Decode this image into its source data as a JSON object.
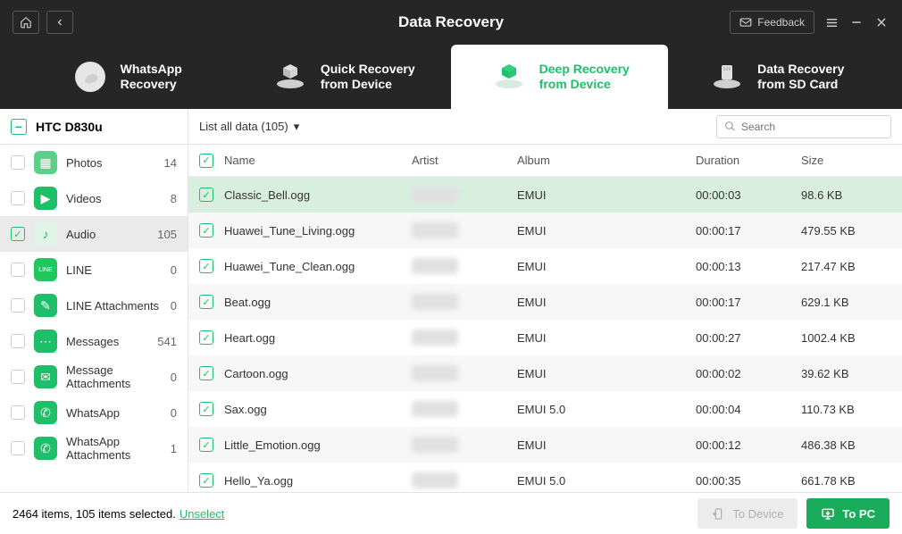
{
  "titlebar": {
    "title": "Data Recovery",
    "feedback": "Feedback"
  },
  "tabs": [
    {
      "l1": "WhatsApp",
      "l2": "Recovery"
    },
    {
      "l1": "Quick Recovery",
      "l2": "from Device"
    },
    {
      "l1": "Deep Recovery",
      "l2": "from Device"
    },
    {
      "l1": "Data Recovery",
      "l2": "from SD Card"
    }
  ],
  "device": "HTC D830u",
  "sidebar": [
    {
      "label": "Photos",
      "count": "14",
      "checked": false,
      "bg": "#5cd08a",
      "glyph": "▦"
    },
    {
      "label": "Videos",
      "count": "8",
      "checked": false,
      "bg": "#1fbf6a",
      "glyph": "▶"
    },
    {
      "label": "Audio",
      "count": "105",
      "checked": true,
      "bg": "#dff3e7",
      "glyph": "♪",
      "fg": "#1fbf6a"
    },
    {
      "label": "LINE",
      "count": "0",
      "checked": false,
      "bg": "#22c55e",
      "glyph": "LINE",
      "fs": "7"
    },
    {
      "label": "LINE Attachments",
      "count": "0",
      "checked": false,
      "bg": "#1fbf6a",
      "glyph": "✎"
    },
    {
      "label": "Messages",
      "count": "541",
      "checked": false,
      "bg": "#1fbf6a",
      "glyph": "⋯"
    },
    {
      "label": "Message Attachments",
      "count": "0",
      "checked": false,
      "bg": "#1fbf6a",
      "glyph": "✉"
    },
    {
      "label": "WhatsApp",
      "count": "0",
      "checked": false,
      "bg": "#1fbf6a",
      "glyph": "✆"
    },
    {
      "label": "WhatsApp Attachments",
      "count": "1",
      "checked": false,
      "bg": "#1fbf6a",
      "glyph": "✆"
    }
  ],
  "listLabel": "List all data (105)",
  "searchPlaceholder": "Search",
  "columns": {
    "name": "Name",
    "artist": "Artist",
    "album": "Album",
    "duration": "Duration",
    "size": "Size"
  },
  "rows": [
    {
      "name": "Classic_Bell.ogg",
      "album": "EMUI",
      "duration": "00:00:03",
      "size": "98.6 KB",
      "sel": true
    },
    {
      "name": "Huawei_Tune_Living.ogg",
      "album": "EMUI",
      "duration": "00:00:17",
      "size": "479.55 KB"
    },
    {
      "name": "Huawei_Tune_Clean.ogg",
      "album": "EMUI",
      "duration": "00:00:13",
      "size": "217.47 KB"
    },
    {
      "name": "Beat.ogg",
      "album": "EMUI",
      "duration": "00:00:17",
      "size": "629.1 KB"
    },
    {
      "name": "Heart.ogg",
      "album": "EMUI",
      "duration": "00:00:27",
      "size": "1002.4 KB"
    },
    {
      "name": "Cartoon.ogg",
      "album": "EMUI",
      "duration": "00:00:02",
      "size": "39.62 KB"
    },
    {
      "name": "Sax.ogg",
      "album": "EMUI 5.0",
      "duration": "00:00:04",
      "size": "110.73 KB"
    },
    {
      "name": "Little_Emotion.ogg",
      "album": "EMUI",
      "duration": "00:00:12",
      "size": "486.38 KB"
    },
    {
      "name": "Hello_Ya.ogg",
      "album": "EMUI 5.0",
      "duration": "00:00:35",
      "size": "661.78 KB"
    }
  ],
  "footer": {
    "status": "2464 items, 105 items selected.",
    "unselect": "Unselect",
    "toDevice": "To Device",
    "toPC": "To PC"
  }
}
